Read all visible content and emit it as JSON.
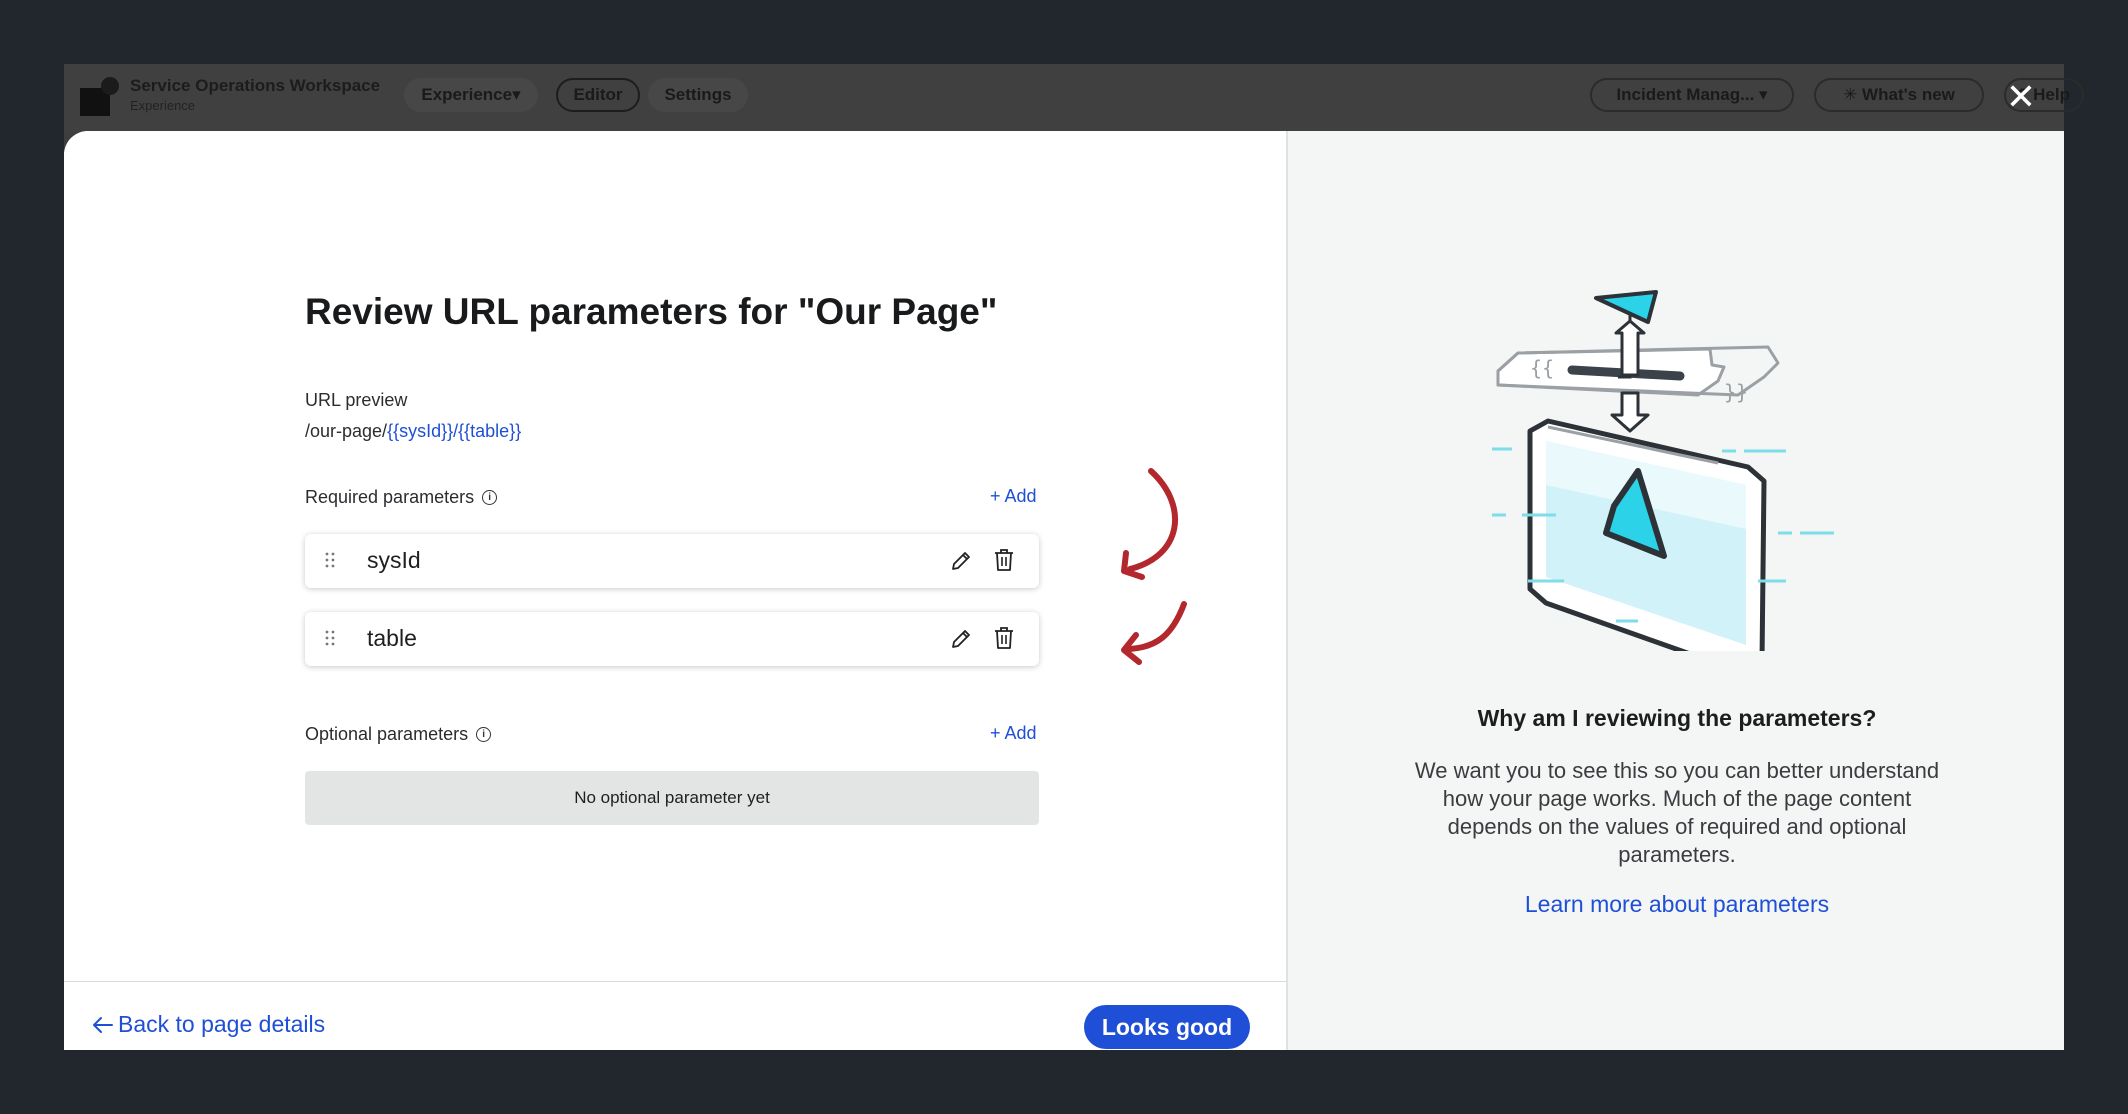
{
  "app_header": {
    "title": "Service Operations Workspace",
    "subtitle": "Experience",
    "experience_menu": "Experience▾",
    "editor_tab": "Editor",
    "settings_tab": "Settings",
    "incident_menu": "Incident Manag... ▾",
    "whats_new": "✳ What's new",
    "help": "? Help"
  },
  "modal": {
    "close_glyph": "✕",
    "heading": "Review URL parameters for \"Our Page\"",
    "url_preview": {
      "label": "URL preview",
      "prefix": "/our-page/",
      "token1": "{{sysId}}",
      "separator": "/",
      "token2": "{{table}}"
    },
    "required": {
      "label": "Required parameters",
      "add_label": "+ Add",
      "items": [
        {
          "name": "sysId"
        },
        {
          "name": "table"
        }
      ]
    },
    "optional": {
      "label": "Optional parameters",
      "add_label": "+ Add",
      "empty_text": "No optional parameter yet"
    },
    "footer": {
      "back_label": "Back to page details",
      "primary_label": "Looks good"
    },
    "side_panel": {
      "title": "Why am I reviewing the parameters?",
      "body": "We want you to see this so you can better understand how your page works. Much of the page content depends on the values of required and optional parameters.",
      "link": "Learn more about parameters"
    }
  },
  "colors": {
    "accent": "#1f4fd6",
    "annotation_arrow": "#b3282d",
    "illustration_cyan": "#2bd2e8"
  }
}
